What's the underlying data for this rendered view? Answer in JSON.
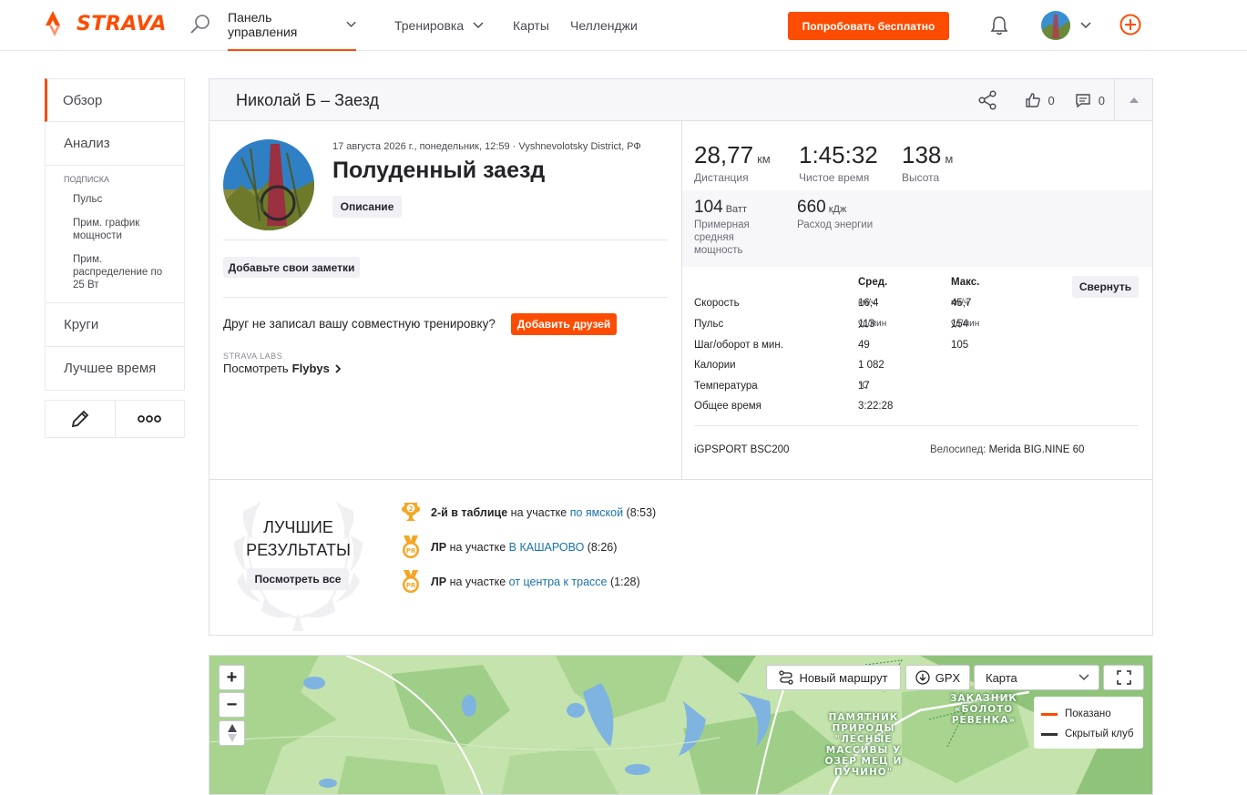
{
  "brand": {
    "name": "STRAVA",
    "accent": "#fc4c02"
  },
  "nav": {
    "dashboard": "Панель управления",
    "training": "Тренировка",
    "maps": "Карты",
    "challenges": "Челленджи",
    "try_free": "Попробовать бесплатно"
  },
  "sidebar": {
    "overview": "Обзор",
    "analysis": "Анализ",
    "subscription_title": "ПОДПИСКА",
    "sub_items": [
      "Пульс",
      "Прим. график мощности",
      "Прим. распределение по 25 Вт"
    ],
    "laps": "Круги",
    "best_times": "Лучшее время"
  },
  "activity": {
    "header_title": "Николай Б – Заезд",
    "kudos_count": "0",
    "comments_count": "0",
    "meta": "17 августа 2026 г., понедельник, 12:59 · Vyshnevolotsky District, РФ",
    "title": "Полуденный заезд",
    "description_btn": "Описание",
    "notes_btn": "Добавьте свои заметки",
    "friend_question": "Друг не записал вашу совместную тренировку?",
    "add_friends_btn": "Добавить друзей",
    "labs": "STRAVA LABS",
    "flyby_prefix": "Посмотреть",
    "flyby_bold": "Flybys"
  },
  "stats": {
    "distance": {
      "value": "28,77",
      "unit": "км",
      "label": "Дистанция"
    },
    "moving_time": {
      "value": "1:45:32",
      "label": "Чистое время"
    },
    "elevation": {
      "value": "138",
      "unit": "м",
      "label": "Высота"
    },
    "power": {
      "value": "104",
      "unit": "Ватт",
      "label": "Примерная средняя мощность"
    },
    "energy": {
      "value": "660",
      "unit": "кДж",
      "label": "Расход энергии"
    }
  },
  "table": {
    "avg_header": "Сред.",
    "max_header": "Макс.",
    "collapse_btn": "Свернуть",
    "rows": [
      {
        "label": "Скорость",
        "avg": "16,4",
        "avg_unit": "км/ч",
        "max": "45,7",
        "max_unit": "км/ч"
      },
      {
        "label": "Пульс",
        "avg": "113",
        "avg_unit": "уд/мин",
        "max": "154",
        "max_unit": "уд/мин"
      },
      {
        "label": "Шаг/оборот в мин.",
        "avg": "49",
        "avg_unit": "",
        "max": "105",
        "max_unit": ""
      },
      {
        "label": "Калории",
        "avg": "1 082",
        "avg_unit": "",
        "max": "",
        "max_unit": ""
      },
      {
        "label": "Температура",
        "avg": "17",
        "avg_unit": "℃",
        "max": "",
        "max_unit": ""
      },
      {
        "label": "Общее время",
        "avg": "3:22:28",
        "avg_unit": "",
        "max": "",
        "max_unit": ""
      }
    ],
    "device": "iGPSPORT BSC200",
    "bike_label": "Велосипед:",
    "bike": "Merida BIG.NINE 60"
  },
  "best": {
    "title_line1": "ЛУЧШИЕ",
    "title_line2": "РЕЗУЛЬТАТЫ",
    "see_all": "Посмотреть все",
    "items": [
      {
        "badge": "2",
        "bold": "2-й в таблице",
        "mid": " на участке ",
        "segment": "по ямской",
        "time": " (8:53)"
      },
      {
        "badge": "PR",
        "bold": "ЛР",
        "mid": " на участке ",
        "segment": "В КАШАРОВО",
        "time": " (8:26)"
      },
      {
        "badge": "PR",
        "bold": "ЛР",
        "mid": " на участке ",
        "segment": "от центра к трассе",
        "time": " (1:28)"
      }
    ]
  },
  "map": {
    "zoom_in": "+",
    "zoom_out": "−",
    "new_route": "Новый маршрут",
    "gpx": "GPX",
    "map_type": "Карта",
    "legend_shown": "Показано",
    "legend_hidden": "Скрытый клуб",
    "label_nature": "ПАМЯТНИК ПРИРОДЫ \"ЛЕСНЫЕ МАССИВЫ У ОЗЕР МЕЦ И ПУЧИНО\"",
    "label_reserve": "ЗАКАЗНИК «БОЛОТО РЕВЕНКА»",
    "shown_color": "#fc4c02",
    "hidden_color": "#333333"
  }
}
